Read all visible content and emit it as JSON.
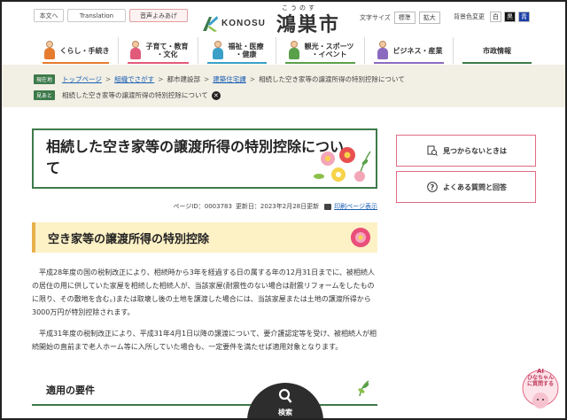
{
  "utility": {
    "text_only": "本文へ",
    "translation": "Translation",
    "read_aloud": "音声よみあげ"
  },
  "logo": {
    "en": "KONOSU",
    "ruby": "こうのす",
    "jp": "鴻巣市"
  },
  "font_size": {
    "label": "文字サイズ",
    "standard": "標準",
    "large": "拡大"
  },
  "bg_color": {
    "label": "背景色変更",
    "white": "白",
    "black": "黒",
    "blue": "青"
  },
  "nav": [
    {
      "label": "くらし・手続き",
      "color": "#e67c2e"
    },
    {
      "label": "子育て・教育\n・文化",
      "color": "#e25a7a"
    },
    {
      "label": "福祉・医療\n・健康",
      "color": "#3aa0c8"
    },
    {
      "label": "観光・スポーツ\n・イベント",
      "color": "#5aa04a"
    },
    {
      "label": "ビジネス・産業",
      "color": "#8b6bc0"
    },
    {
      "label": "市政情報",
      "color": "#3d7a4a"
    }
  ],
  "breadcrumb": {
    "current_tag": "現在地",
    "items": [
      "トップページ",
      "組織でさがす",
      "都市建設部",
      "建築住宅課",
      "相続した空き家等の譲渡所得の特別控除について"
    ],
    "history_tag": "見あと",
    "history_item": "相続した空き家等の譲渡所得の特別控除について"
  },
  "page": {
    "title": "相続した空き家等の譲渡所得の特別控除について",
    "page_id": "ページID：0003783",
    "updated": "更新日：2023年2月28日更新",
    "print_link": "印刷ページ表示",
    "h2": "空き家等の譲渡所得の特別控除",
    "para1": "平成28年度の国の税制改正により、相続時から3年を経過する日の属する年の12月31日までに、被相続人の居住の用に供していた家屋を相続した相続人が、当該家屋(耐震性のない場合は耐震リフォームをしたものに限り、その敷地を含む。)または取壊し後の土地を譲渡した場合には、当該家屋または土地の譲渡所得から3000万円が特別控除されます。",
    "para2": "平成31年度の税制改正により、平成31年4月1日以降の譲渡について、要介護認定等を受け、被相続人が相続開始の直前まで老人ホーム等に入所していた場合も、一定要件を満たせば適用対象となります。",
    "h3": "適用の要件"
  },
  "sidebar": {
    "not_found": "見つからないときは",
    "faq": "よくある質問と回答"
  },
  "search": {
    "label": "検索"
  },
  "ai_chat": {
    "line1": "AI",
    "line2": "ひなちゃん",
    "line3": "に質問する"
  },
  "colors": {
    "green": "#3d7a4a",
    "pink": "#e06a84",
    "yellow_bg": "#fdf1c6",
    "crumb_bg": "#f2efe4"
  }
}
